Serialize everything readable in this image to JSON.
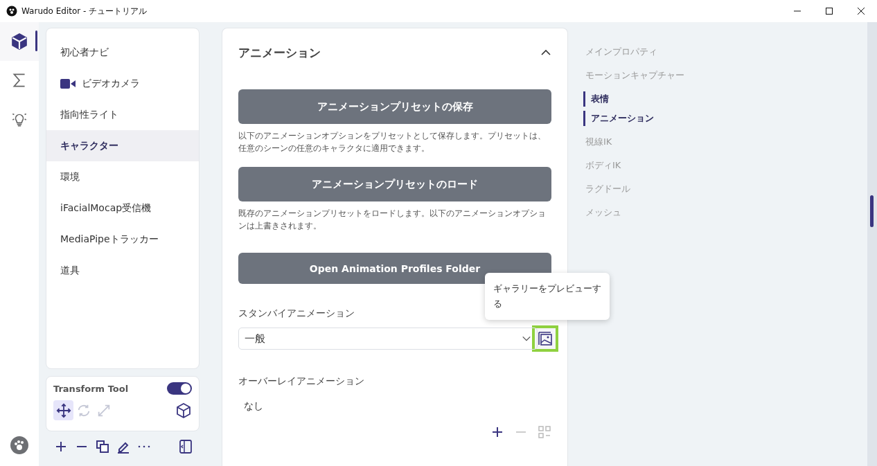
{
  "window": {
    "title": "Warudo Editor - チュートリアル"
  },
  "rail": [
    {
      "selected": true
    },
    {
      "selected": false
    },
    {
      "selected": false
    }
  ],
  "sidebar": {
    "items": [
      {
        "label": "初心者ナビ",
        "kind": "plain",
        "selected": false
      },
      {
        "label": "ビデオカメラ",
        "kind": "camera",
        "selected": false
      },
      {
        "label": "指向性ライト",
        "kind": "plain",
        "selected": false
      },
      {
        "label": "キャラクター",
        "kind": "plain",
        "selected": true
      },
      {
        "label": "環境",
        "kind": "plain",
        "selected": false
      },
      {
        "label": "iFacialMocap受信機",
        "kind": "plain",
        "selected": false
      },
      {
        "label": "MediaPipeトラッカー",
        "kind": "plain",
        "selected": false
      },
      {
        "label": "道具",
        "kind": "plain",
        "selected": false
      }
    ]
  },
  "transform_tool": {
    "label": "Transform Tool",
    "on": true,
    "modes": [
      {
        "selected": true,
        "disabled": false
      },
      {
        "selected": false,
        "disabled": true
      },
      {
        "selected": false,
        "disabled": true
      }
    ]
  },
  "section": {
    "title": "アニメーション",
    "expanded": true,
    "actions": [
      {
        "label": "アニメーションプリセットの保存",
        "description": "以下のアニメーションオプションをプリセットとして保存します。プリセットは、任意のシーンの任意のキャラクタに適用できます。"
      },
      {
        "label": "アニメーションプリセットのロード",
        "description": "既存のアニメーションプリセットをロードします。以下のアニメーションオプションは上書きされます。"
      },
      {
        "label": "Open Animation Profiles Folder"
      }
    ],
    "standby": {
      "label": "スタンバイアニメーション",
      "value": "一般"
    },
    "overlay": {
      "label": "オーバーレイアニメーション",
      "value": "なし"
    }
  },
  "tooltip": {
    "text": "ギャラリーをプレビューする"
  },
  "nav": [
    {
      "label": "メインプロパティ",
      "selected": false
    },
    {
      "label": "モーションキャプチャー",
      "selected": false
    },
    {
      "label": "表情",
      "selected": true
    },
    {
      "label": "アニメーション",
      "selected": true
    },
    {
      "label": "視線IK",
      "selected": false
    },
    {
      "label": "ボディIK",
      "selected": false
    },
    {
      "label": "ラグドール",
      "selected": false
    },
    {
      "label": "メッシュ",
      "selected": false
    }
  ]
}
